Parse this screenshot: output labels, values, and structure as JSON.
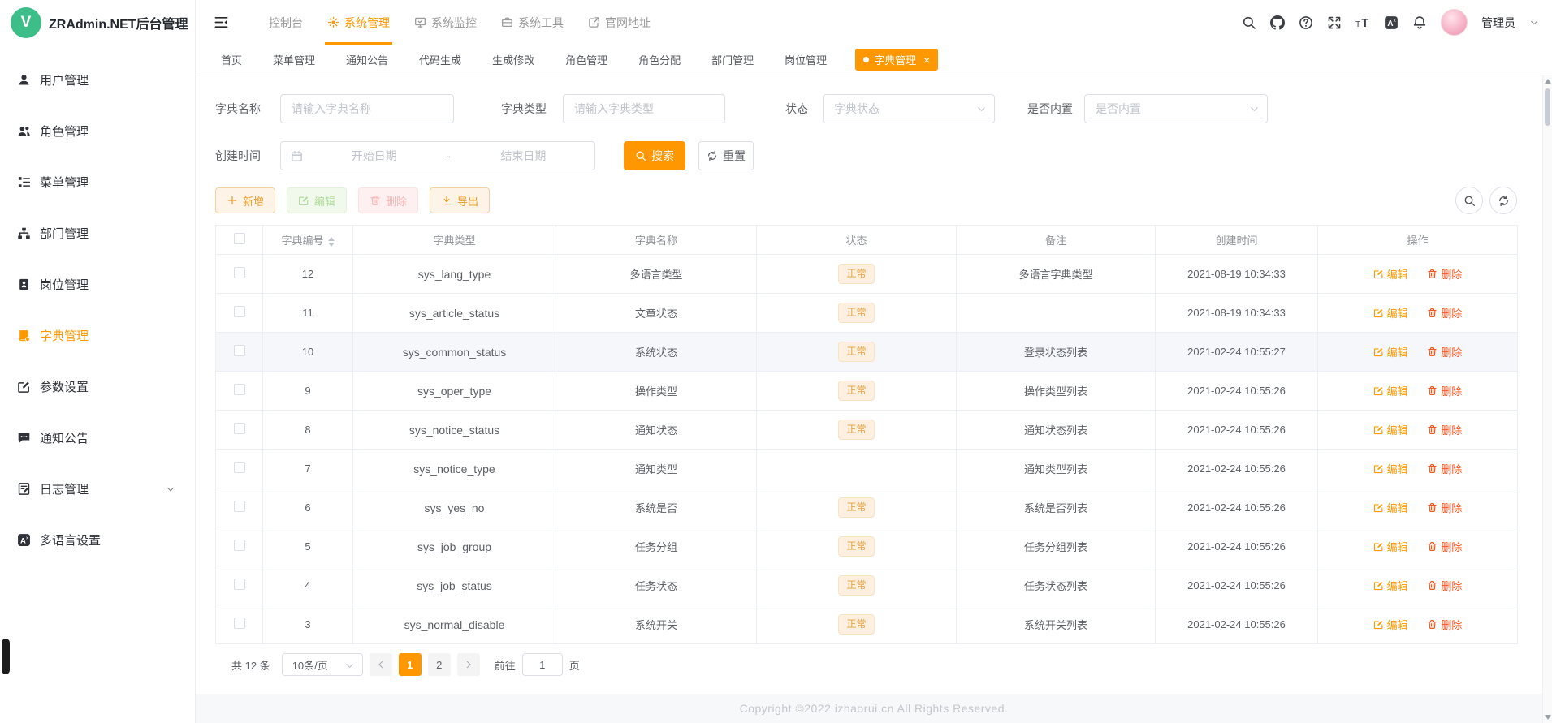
{
  "app": {
    "title": "ZRAdmin.NET后台管理",
    "logo_letter": "V"
  },
  "colors": {
    "accent": "#ff9800",
    "search_button": "#ff9700",
    "link_orange": "#ff9800",
    "delete_link": "#fa541c",
    "badge_text": "#e6a23c",
    "badge_bg": "#fdf0e1",
    "logo_green": "#3dbd87"
  },
  "header": {
    "nav": [
      {
        "label": "控制台",
        "icon": "",
        "active": false
      },
      {
        "label": "系统管理",
        "icon": "gear-icon",
        "active": true
      },
      {
        "label": "系统监控",
        "icon": "monitor-icon",
        "active": false
      },
      {
        "label": "系统工具",
        "icon": "toolbox-icon",
        "active": false
      },
      {
        "label": "官网地址",
        "icon": "external-link-icon",
        "active": false
      }
    ],
    "tools": [
      {
        "name": "search-icon"
      },
      {
        "name": "github-icon"
      },
      {
        "name": "help-icon"
      },
      {
        "name": "fullscreen-icon"
      },
      {
        "name": "font-size-icon"
      },
      {
        "name": "language-icon"
      },
      {
        "name": "bell-icon",
        "badge": true
      }
    ],
    "user_name": "管理员"
  },
  "tabs": [
    {
      "label": "首页"
    },
    {
      "label": "菜单管理"
    },
    {
      "label": "通知公告"
    },
    {
      "label": "代码生成"
    },
    {
      "label": "生成修改"
    },
    {
      "label": "角色管理"
    },
    {
      "label": "角色分配"
    },
    {
      "label": "部门管理"
    },
    {
      "label": "岗位管理"
    },
    {
      "label": "字典管理",
      "active": true,
      "closable": true
    }
  ],
  "sidebar": [
    {
      "label": "用户管理",
      "icon": "user-icon"
    },
    {
      "label": "角色管理",
      "icon": "roles-icon"
    },
    {
      "label": "菜单管理",
      "icon": "menu-tree-icon"
    },
    {
      "label": "部门管理",
      "icon": "org-chart-icon"
    },
    {
      "label": "岗位管理",
      "icon": "id-badge-icon"
    },
    {
      "label": "字典管理",
      "icon": "dictionary-icon",
      "active": true
    },
    {
      "label": "参数设置",
      "icon": "settings-pen-icon"
    },
    {
      "label": "通知公告",
      "icon": "megaphone-icon"
    },
    {
      "label": "日志管理",
      "icon": "log-icon",
      "expandable": true
    },
    {
      "label": "多语言设置",
      "icon": "translate-icon"
    }
  ],
  "filters": {
    "dict_name_label": "字典名称",
    "dict_name_placeholder": "请输入字典名称",
    "dict_type_label": "字典类型",
    "dict_type_placeholder": "请输入字典类型",
    "status_label": "状态",
    "status_placeholder": "字典状态",
    "builtin_label": "是否内置",
    "builtin_placeholder": "是否内置",
    "create_time_label": "创建时间",
    "date_start_placeholder": "开始日期",
    "date_separator": "-",
    "date_end_placeholder": "结束日期",
    "search_button": "搜索",
    "reset_button": "重置"
  },
  "toolbar": {
    "add": "新增",
    "edit": "编辑",
    "delete": "删除",
    "export": "导出"
  },
  "table": {
    "columns": {
      "id": "字典编号",
      "type": "字典类型",
      "name": "字典名称",
      "status": "状态",
      "remark": "备注",
      "created": "创建时间",
      "actions": "操作"
    },
    "edit_action": "编辑",
    "delete_action": "删除",
    "edit_icon": "edit-pen-icon",
    "delete_icon": "trash-icon",
    "rows": [
      {
        "id": "12",
        "type": "sys_lang_type",
        "name": "多语言类型",
        "status": "正常",
        "remark": "多语言字典类型",
        "created": "2021-08-19 10:34:33"
      },
      {
        "id": "11",
        "type": "sys_article_status",
        "name": "文章状态",
        "status": "正常",
        "remark": "",
        "created": "2021-08-19 10:34:33"
      },
      {
        "id": "10",
        "type": "sys_common_status",
        "name": "系统状态",
        "status": "正常",
        "remark": "登录状态列表",
        "created": "2021-02-24 10:55:27",
        "highlight": true
      },
      {
        "id": "9",
        "type": "sys_oper_type",
        "name": "操作类型",
        "status": "正常",
        "remark": "操作类型列表",
        "created": "2021-02-24 10:55:26"
      },
      {
        "id": "8",
        "type": "sys_notice_status",
        "name": "通知状态",
        "status": "正常",
        "remark": "通知状态列表",
        "created": "2021-02-24 10:55:26"
      },
      {
        "id": "7",
        "type": "sys_notice_type",
        "name": "通知类型",
        "status": "",
        "remark": "通知类型列表",
        "created": "2021-02-24 10:55:26"
      },
      {
        "id": "6",
        "type": "sys_yes_no",
        "name": "系统是否",
        "status": "正常",
        "remark": "系统是否列表",
        "created": "2021-02-24 10:55:26"
      },
      {
        "id": "5",
        "type": "sys_job_group",
        "name": "任务分组",
        "status": "正常",
        "remark": "任务分组列表",
        "created": "2021-02-24 10:55:26"
      },
      {
        "id": "4",
        "type": "sys_job_status",
        "name": "任务状态",
        "status": "正常",
        "remark": "任务状态列表",
        "created": "2021-02-24 10:55:26"
      },
      {
        "id": "3",
        "type": "sys_normal_disable",
        "name": "系统开关",
        "status": "正常",
        "remark": "系统开关列表",
        "created": "2021-02-24 10:55:26"
      }
    ]
  },
  "pagination": {
    "total": "共 12 条",
    "page_size": "10条/页",
    "pages": [
      "1",
      "2"
    ],
    "active_page": "1",
    "goto_label": "前往",
    "goto_value": "1",
    "goto_unit": "页"
  },
  "footer": {
    "copyright": "Copyright ©2022 izhaorui.cn All Rights Reserved."
  }
}
